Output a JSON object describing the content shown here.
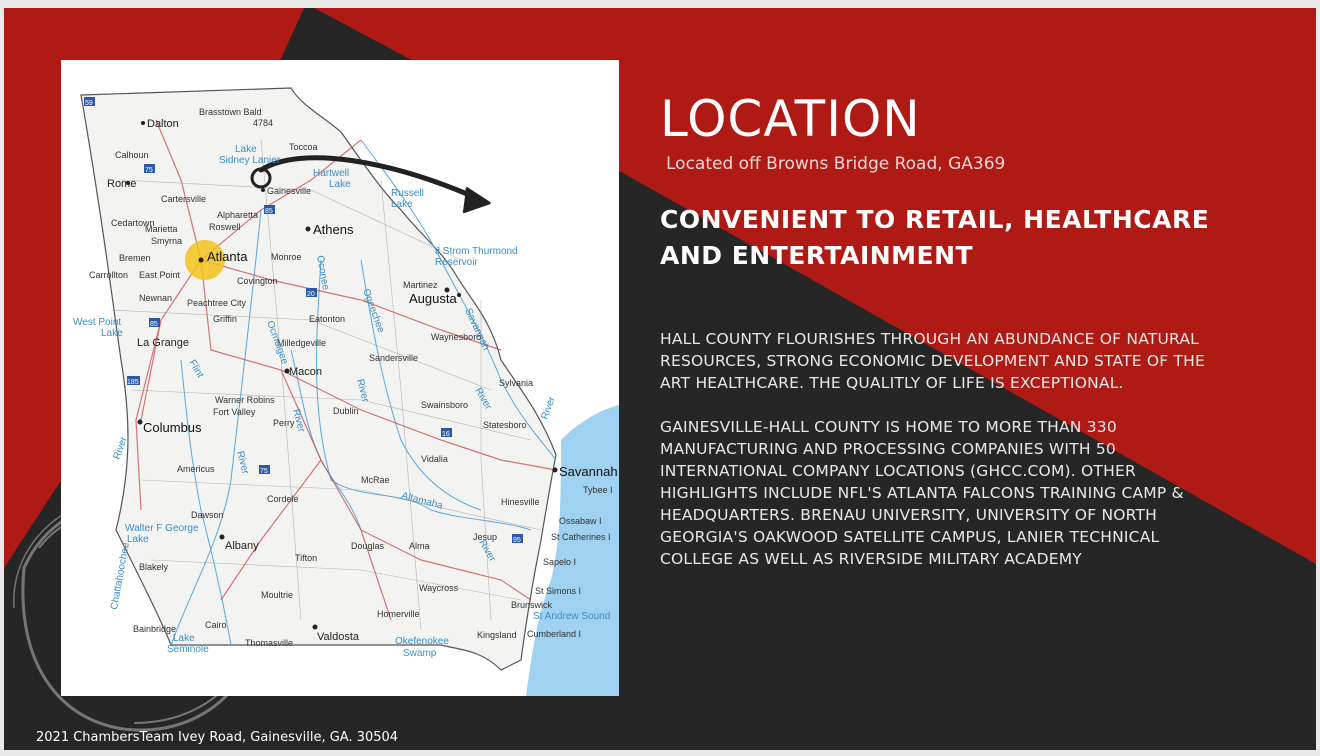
{
  "slide": {
    "title": "LOCATION",
    "subtitle": "Located off Browns Bridge Road, GA369",
    "headline_lines": [
      "CONVENIENT TO RETAIL, HEALTHCARE",
      " AND ENTERTAINMENT"
    ],
    "paragraph1_lines": [
      " HALL COUNTY FLOURISHES THROUGH AN ABUNDANCE OF NATURAL",
      "RESOURCES, STRONG ECONOMIC DEVELOPMENT AND STATE OF THE",
      "ART HEALTHCARE. THE QUALITLY OF LIFE IS EXCEPTIONAL."
    ],
    "paragraph2_lines": [
      "GAINESVILLE-HALL COUNTY IS HOME TO MORE THAN 330",
      "MANUFACTURING AND PROCESSING COMPANIES WITH 50",
      "INTERNATIONAL COMPANY LOCATIONS (GHCC.COM).  OTHER",
      "HIGHLIGHTS INCLUDE NFL'S ATLANTA FALCONS  TRAINING CAMP &",
      "HEADQUARTERS.  BRENAU UNIVERSITY,  UNIVERSITY OF NORTH",
      "GEORGIA'S OAKWOOD SATELLITE CAMPUS, LANIER TECHNICAL",
      "COLLEGE AS WELL AS RIVERSIDE MILITARY ACADEMY"
    ],
    "footer": "2021 ChambersTeam  Ivey Road, Gainesville, GA. 30504"
  },
  "colors": {
    "red": "#b01a14",
    "dark": "#262626",
    "white": "#ffffff",
    "map_land": "#f4f4f2",
    "map_water": "#9fd1f1",
    "road_red": "#c74b4b",
    "marker": "#f2c21b"
  },
  "map": {
    "labels": {
      "brasstown": "Brasstown Bald",
      "brasstown_elev": "4784",
      "dalton": "Dalton",
      "calhoun": "Calhoun",
      "toccoa": "Toccoa",
      "lake_sidney": "Lake",
      "lake_sidney2": "Sidney Lanier",
      "hartwell": "Hartwell",
      "hartwell2": "Lake",
      "rome": "Rome",
      "cartersville": "Cartersville",
      "gainesville": "Gainesville",
      "russell": "Russell",
      "russell2": "Lake",
      "cedartown": "Cedartown",
      "alpharetta": "Alpharetta",
      "roswell": "Roswell",
      "marietta": "Marietta",
      "smyrna": "Smyrna",
      "athens": "Athens",
      "strom": "J Strom Thurmond",
      "strom2": "Reservoir",
      "bremen": "Bremen",
      "atlanta": "Atlanta",
      "monroe": "Monroe",
      "carrollton": "Carrollton",
      "east_point": "East Point",
      "covington": "Covington",
      "martinez": "Martinez",
      "augusta": "Augusta",
      "newnan": "Newnan",
      "peachtree": "Peachtree City",
      "savannah_river": "Savannah",
      "west_point": "West Point",
      "west_point2": "Lake",
      "griffin": "Griffin",
      "eatonton": "Eatonton",
      "waynesboro": "Waynesboro",
      "la_grange": "La Grange",
      "milledgeville": "Milledgeville",
      "sandersville": "Sandersville",
      "macon": "Macon",
      "flint": "Flint",
      "sylvania": "Sylvania",
      "warner_robins": "Warner Robins",
      "fort_valley": "Fort Valley",
      "perry": "Perry",
      "dublin": "Dublin",
      "swainsboro": "Swainsboro",
      "statesboro": "Statesboro",
      "columbus": "Columbus",
      "americus": "Americus",
      "vidalia": "Vidalia",
      "savannah": "Savannah",
      "tybee": "Tybee I",
      "cordele": "Cordele",
      "mcrae": "McRae",
      "altamaha": "Altamaha",
      "hinesville": "Hinesville",
      "dawson": "Dawson",
      "ossabaw": "Ossabaw I",
      "walter_george": "Walter F George",
      "walter_george2": "Lake",
      "st_catherines": "St Catherines I",
      "albany": "Albany",
      "douglas": "Douglas",
      "alma": "Alma",
      "jesup": "Jesup",
      "sapelo": "Sapelo I",
      "tifton": "Tifton",
      "blakely": "Blakely",
      "chattahoochee": "Chattahoochee",
      "waycross": "Waycross",
      "moultrie": "Moultrie",
      "st_simons": "St Simons I",
      "brunswick": "Brunswick",
      "st_andrew": "St Andrew Sound",
      "bainbridge": "Bainbridge",
      "cairo": "Cairo",
      "homerville": "Homerville",
      "lake_seminole": "Lake",
      "lake_seminole2": "Seminole",
      "thomasville": "Thomasville",
      "valdosta": "Valdosta",
      "okefenokee": "Okefenokee",
      "okefenokee2": "Swamp",
      "kingsland": "Kingsland",
      "cumberland": "Cumberland I",
      "ocmulgee": "Ocmulgee",
      "oconee": "Oconee",
      "ogeechee": "Ogeechee",
      "river": "River"
    },
    "highways": {
      "i59": "59",
      "i75n": "75",
      "i85n": "85",
      "i20": "20",
      "i85s": "85",
      "i185": "185",
      "i75s": "75",
      "i16": "16",
      "i95": "95"
    }
  }
}
